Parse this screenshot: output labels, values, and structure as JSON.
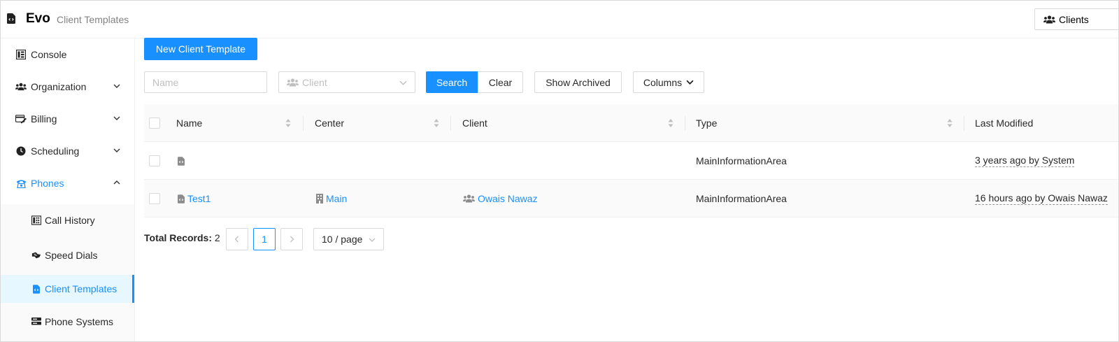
{
  "header": {
    "brand": "Evo",
    "breadcrumb": "Client Templates",
    "clients_button": "Clients"
  },
  "sidebar": {
    "items": [
      {
        "label": "Console",
        "icon": "console-icon"
      },
      {
        "label": "Organization",
        "icon": "organization-icon"
      },
      {
        "label": "Billing",
        "icon": "billing-icon"
      },
      {
        "label": "Scheduling",
        "icon": "clock-icon"
      },
      {
        "label": "Phones",
        "icon": "phone-icon"
      }
    ],
    "submenu": [
      {
        "label": "Call History",
        "icon": "call-history-icon"
      },
      {
        "label": "Speed Dials",
        "icon": "speed-dial-icon"
      },
      {
        "label": "Client Templates",
        "icon": "file-code-icon"
      },
      {
        "label": "Phone Systems",
        "icon": "server-icon"
      }
    ]
  },
  "toolbar": {
    "new_button": "New Client Template",
    "name_placeholder": "Name",
    "client_placeholder": "Client",
    "search_button": "Search",
    "clear_button": "Clear",
    "show_archived_button": "Show Archived",
    "columns_button": "Columns"
  },
  "table": {
    "columns": [
      "Name",
      "Center",
      "Client",
      "Type",
      "Last Modified"
    ],
    "rows": [
      {
        "name": "",
        "center": "",
        "client": "",
        "type": "MainInformationArea",
        "last_modified": "3 years ago by System"
      },
      {
        "name": "Test1",
        "center": "Main",
        "client": "Owais Nawaz",
        "type": "MainInformationArea",
        "last_modified": "16 hours ago by Owais Nawaz"
      }
    ]
  },
  "pagination": {
    "total_label": "Total Records:",
    "total_value": "2",
    "current_page": "1",
    "page_size": "10 / page"
  },
  "colors": {
    "primary": "#1890ff",
    "active_bg": "#e6f7ff",
    "header_bg": "#fafafa"
  }
}
